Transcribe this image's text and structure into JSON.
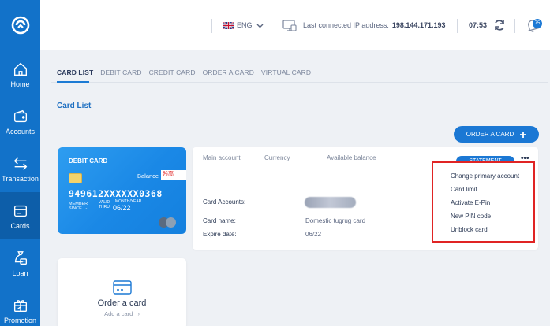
{
  "sidebar": {
    "items": [
      {
        "label": "Home",
        "icon": "home-icon"
      },
      {
        "label": "Accounts",
        "icon": "wallet-icon"
      },
      {
        "label": "Transaction",
        "icon": "transfer-arrows-icon"
      },
      {
        "label": "Cards",
        "icon": "card-icon"
      },
      {
        "label": "Loan",
        "icon": "money-bag-icon"
      },
      {
        "label": "Promotion",
        "icon": "gift-percent-icon"
      }
    ],
    "active": "Cards"
  },
  "header": {
    "language": "ENG",
    "ip_label": "Last connected IP address.",
    "ip_value": "198.144.171.193",
    "time": "07:53",
    "notifications": "75"
  },
  "tabs": [
    "CARD LIST",
    "DEBIT CARD",
    "CREDIT CARD",
    "ORDER A CARD",
    "VIRTUAL CARD"
  ],
  "section_title": "Card List",
  "order_button": "ORDER A CARD",
  "card": {
    "type": "DEBIT CARD",
    "balance_label": "Balance",
    "balance_value": "残高",
    "number": "949612XXXXXX0368",
    "member_since": "MEMBER SINCE",
    "member_since_value": "-",
    "valid_thru": "VALID THRU",
    "month_year": "MONTH/YEAR",
    "expiry": "06/22"
  },
  "details": {
    "headers": [
      "Main account",
      "Currency",
      "Available balance"
    ],
    "statement_button": "STATEMENT",
    "rows": [
      {
        "label": "Card Accounts:",
        "value": ""
      },
      {
        "label": "Card name:",
        "value": "Domestic tugrug card"
      },
      {
        "label": "Expire date:",
        "value": "06/22"
      }
    ]
  },
  "context_menu": [
    "Change primary account",
    "Card limit",
    "Activate E-Pin",
    "New PIN code",
    "Unblock card"
  ],
  "order_card": {
    "title": "Order a card",
    "subtitle": "Add a card",
    "arrow": "›"
  },
  "colors": {
    "primary": "#1b78d4",
    "sidebar": "#1272c9",
    "highlight": "#e02424"
  }
}
